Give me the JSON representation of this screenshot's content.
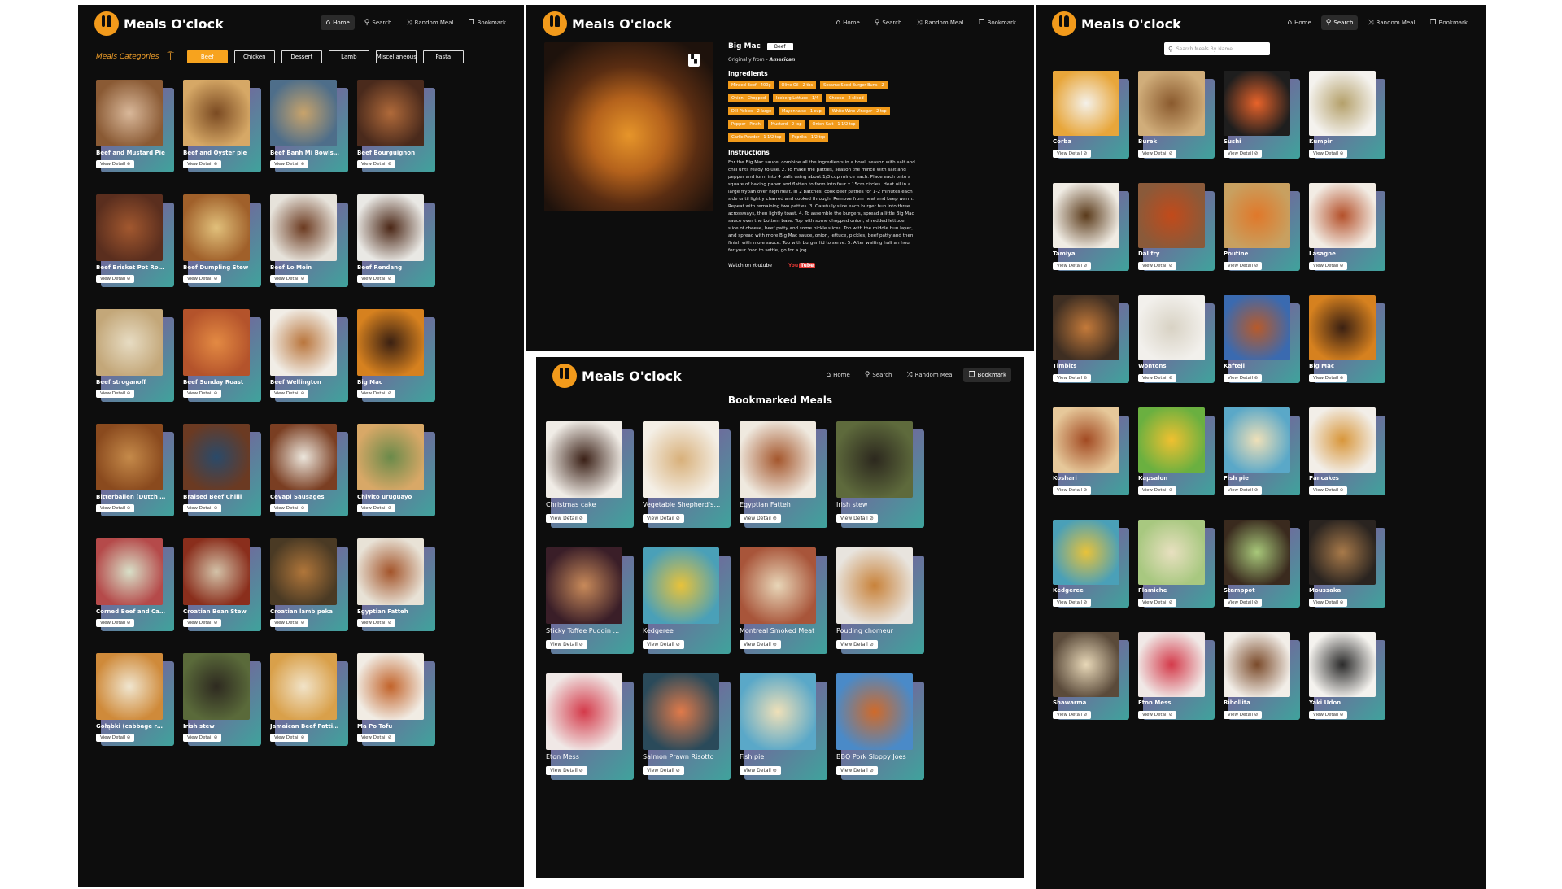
{
  "brand": {
    "name": "Meals O'clock",
    "accent": "#f29a1b"
  },
  "nav": {
    "home": "Home",
    "search": "Search",
    "random": "Random Meal",
    "bookmark": "Bookmark"
  },
  "categories": {
    "label": "Meals Categories",
    "items": [
      "Beef",
      "Chicken",
      "Dessert",
      "Lamb",
      "Miscellaneous",
      "Pasta"
    ],
    "selected": "Beef"
  },
  "view_detail": "View Detail",
  "beef_meals": [
    {
      "title": "Beef and Mustard Pie",
      "c1": "#8a5a34",
      "c2": "#d9b89a"
    },
    {
      "title": "Beef and Oyster pie",
      "c1": "#d6a866",
      "c2": "#7a4a22"
    },
    {
      "title": "Beef Banh Mi Bowls w ...",
      "c1": "#4e6e8a",
      "c2": "#c8a36b"
    },
    {
      "title": "Beef Bourguignon",
      "c1": "#4a2a1c",
      "c2": "#b06a3a"
    },
    {
      "title": "Beef Brisket Pot Roast",
      "c1": "#5a2e1e",
      "c2": "#a2582f"
    },
    {
      "title": "Beef Dumpling Stew",
      "c1": "#a0602a",
      "c2": "#e1c07b"
    },
    {
      "title": "Beef Lo Mein",
      "c1": "#e6e2da",
      "c2": "#6b3a20"
    },
    {
      "title": "Beef Rendang",
      "c1": "#e9e8e4",
      "c2": "#4a2615"
    },
    {
      "title": "Beef stroganoff",
      "c1": "#c3a779",
      "c2": "#e7dcc3"
    },
    {
      "title": "Beef Sunday Roast",
      "c1": "#b4532b",
      "c2": "#e38a43"
    },
    {
      "title": "Beef Wellington",
      "c1": "#f1ede6",
      "c2": "#b9753c"
    },
    {
      "title": "Big Mac",
      "c1": "#d6811f",
      "c2": "#3a2012"
    },
    {
      "title": "Bitterballen (Dutch ...",
      "c1": "#8a4a1e",
      "c2": "#c58a4a"
    },
    {
      "title": "Braised Beef Chilli",
      "c1": "#6b3a22",
      "c2": "#2a4a6a"
    },
    {
      "title": "Cevapi Sausages",
      "c1": "#7a3e22",
      "c2": "#ece6dc"
    },
    {
      "title": "Chivito uruguayo",
      "c1": "#d8a867",
      "c2": "#6a8a4a"
    },
    {
      "title": "Corned Beef and Cabb ...",
      "c1": "#b54a4a",
      "c2": "#d8e0c8"
    },
    {
      "title": "Croatian Bean Stew",
      "c1": "#8a2e1c",
      "c2": "#d3c2a8"
    },
    {
      "title": "Croatian lamb peka",
      "c1": "#4a3a24",
      "c2": "#b0763a"
    },
    {
      "title": "Egyptian Fatteh",
      "c1": "#e8e2d6",
      "c2": "#a3542a"
    },
    {
      "title": "Gołąbki (cabbage roll)",
      "c1": "#cf8a3a",
      "c2": "#f0e6d0"
    },
    {
      "title": "Irish stew",
      "c1": "#5a6a3a",
      "c2": "#2e2a20"
    },
    {
      "title": "Jamaican Beef Patties",
      "c1": "#d9a04a",
      "c2": "#f1e3c8"
    },
    {
      "title": "Ma Po Tofu",
      "c1": "#f1ece4",
      "c2": "#c2632a"
    }
  ],
  "detail": {
    "name": "Big Mac",
    "category": "Beef",
    "origin_prefix": "Originally from -",
    "origin": "American",
    "ingredients_heading": "Ingredients",
    "ingredients": [
      "Minced Beef - 400g",
      "Olive Oil - 2 tbs",
      "Sesame Seed Burger Buns - 2",
      "Onion - Chopped",
      "Iceberg Lettuce - 1/4",
      "Cheese - 2 sliced",
      "Dill Pickles - 2 large",
      "Mayonnaise - 1 cup",
      "White Wine Vinegar - 2 tsp",
      "Pepper - Pinch",
      "Mustard - 2 tsp",
      "Onion Salt - 1 1/2 tsp",
      "Garlic Powder - 1 1/2 tsp",
      "Paprika - 1/2 tsp"
    ],
    "instructions_heading": "Instructions",
    "instructions": "For the Big Mac sauce, combine all the ingredients in a bowl, season with salt and chill until ready to use. 2. To make the patties, season the mince with salt and pepper and form into 4 balls using about 1/3 cup mince each. Place each onto a square of baking paper and flatten to form into four x 15cm circles. Heat oil in a large frypan over high heat. In 2 batches, cook beef patties for 1-2 minutes each side until lightly charred and cooked through. Remove from heat and keep warm. Repeat with remaining two patties. 3. Carefully slice each burger bun into three acrossways, then lightly toast. 4. To assemble the burgers, spread a little Big Mac sauce over the bottom base. Top with some chopped onion, shredded lettuce, slice of cheese, beef patty and some pickle slices. Top with the middle bun layer, and spread with more Big Mac sauce, onion, lettuce, pickles, beef patty and then finish with more sauce. Top with burger lid to serve. 5. After waiting half an hour for your food to settle, go for a jog.",
    "watch_label": "Watch on Youtube",
    "youtube": "You",
    "youtube_tube": "Tube"
  },
  "bookmarks": {
    "title": "Bookmarked Meals",
    "items": [
      {
        "title": "Christmas cake",
        "c1": "#f0ece6",
        "c2": "#3a2016"
      },
      {
        "title": "Vegetable Shepherd's ...",
        "c1": "#f4efe6",
        "c2": "#d8b07a"
      },
      {
        "title": "Egyptian Fatteh",
        "c1": "#efe9df",
        "c2": "#a4562c"
      },
      {
        "title": "Irish stew",
        "c1": "#5e6a3c",
        "c2": "#2c281e"
      },
      {
        "title": "Sticky Toffee Puddin ...",
        "c1": "#3a1e28",
        "c2": "#c88a5a"
      },
      {
        "title": "Kedgeree",
        "c1": "#4aa0b8",
        "c2": "#e8c23a"
      },
      {
        "title": "Montreal Smoked Meat",
        "c1": "#a8553a",
        "c2": "#e8d6b8"
      },
      {
        "title": "Pouding chomeur",
        "c1": "#e8e4de",
        "c2": "#c8823a"
      },
      {
        "title": "Eton Mess",
        "c1": "#f0e8e6",
        "c2": "#d43a4a"
      },
      {
        "title": "Salmon Prawn Risotto",
        "c1": "#2a4a5a",
        "c2": "#e07a4a"
      },
      {
        "title": "Fish pie",
        "c1": "#5aa8c8",
        "c2": "#efe0b8"
      },
      {
        "title": "BBQ Pork Sloppy Joes",
        "c1": "#4a8ac8",
        "c2": "#d06a2a"
      }
    ]
  },
  "search": {
    "placeholder": "Search Meals By Name",
    "results": [
      {
        "title": "Corba",
        "c1": "#e8a63a",
        "c2": "#f4f1ea"
      },
      {
        "title": "Burek",
        "c1": "#d0ad7a",
        "c2": "#8a5a2e"
      },
      {
        "title": "Sushi",
        "c1": "#1e1e1e",
        "c2": "#e8632a"
      },
      {
        "title": "Kumpir",
        "c1": "#f4f2ee",
        "c2": "#b4a06a"
      },
      {
        "title": "Tamiya",
        "c1": "#f0ece4",
        "c2": "#5a3a1a"
      },
      {
        "title": "Dal fry",
        "c1": "#8a5a3a",
        "c2": "#c24a1a"
      },
      {
        "title": "Poutine",
        "c1": "#c8a060",
        "c2": "#e0782a"
      },
      {
        "title": "Lasagne",
        "c1": "#f2ece4",
        "c2": "#b4502a"
      },
      {
        "title": "Timbits",
        "c1": "#3e2e22",
        "c2": "#c47a3a"
      },
      {
        "title": "Wontons",
        "c1": "#f2f0ec",
        "c2": "#d8d2c4"
      },
      {
        "title": "Kafteji",
        "c1": "#3a6ab0",
        "c2": "#b85a2a"
      },
      {
        "title": "Big Mac",
        "c1": "#d6811f",
        "c2": "#3a2012"
      },
      {
        "title": "Koshari",
        "c1": "#e6c89a",
        "c2": "#a24a22"
      },
      {
        "title": "Kapsalon",
        "c1": "#6ab040",
        "c2": "#f0c030"
      },
      {
        "title": "Fish pie",
        "c1": "#5aa8c8",
        "c2": "#efe0b8"
      },
      {
        "title": "Pancakes",
        "c1": "#f2eee8",
        "c2": "#d8963a"
      },
      {
        "title": "Kedgeree",
        "c1": "#4aa0b8",
        "c2": "#e8c23a"
      },
      {
        "title": "Flamiche",
        "c1": "#a8c880",
        "c2": "#e8e0c0"
      },
      {
        "title": "Stamppot",
        "c1": "#3a2a1e",
        "c2": "#a8c87a"
      },
      {
        "title": "Moussaka",
        "c1": "#2a2420",
        "c2": "#a87a4a"
      },
      {
        "title": "Shawarma",
        "c1": "#5a4a3a",
        "c2": "#e8d8b8"
      },
      {
        "title": "Eton Mess",
        "c1": "#f0e8e6",
        "c2": "#d43a4a"
      },
      {
        "title": "Ribollita",
        "c1": "#f2eee8",
        "c2": "#7a4a2a"
      },
      {
        "title": "Yaki Udon",
        "c1": "#f4f2ee",
        "c2": "#2a2a2a"
      }
    ]
  }
}
